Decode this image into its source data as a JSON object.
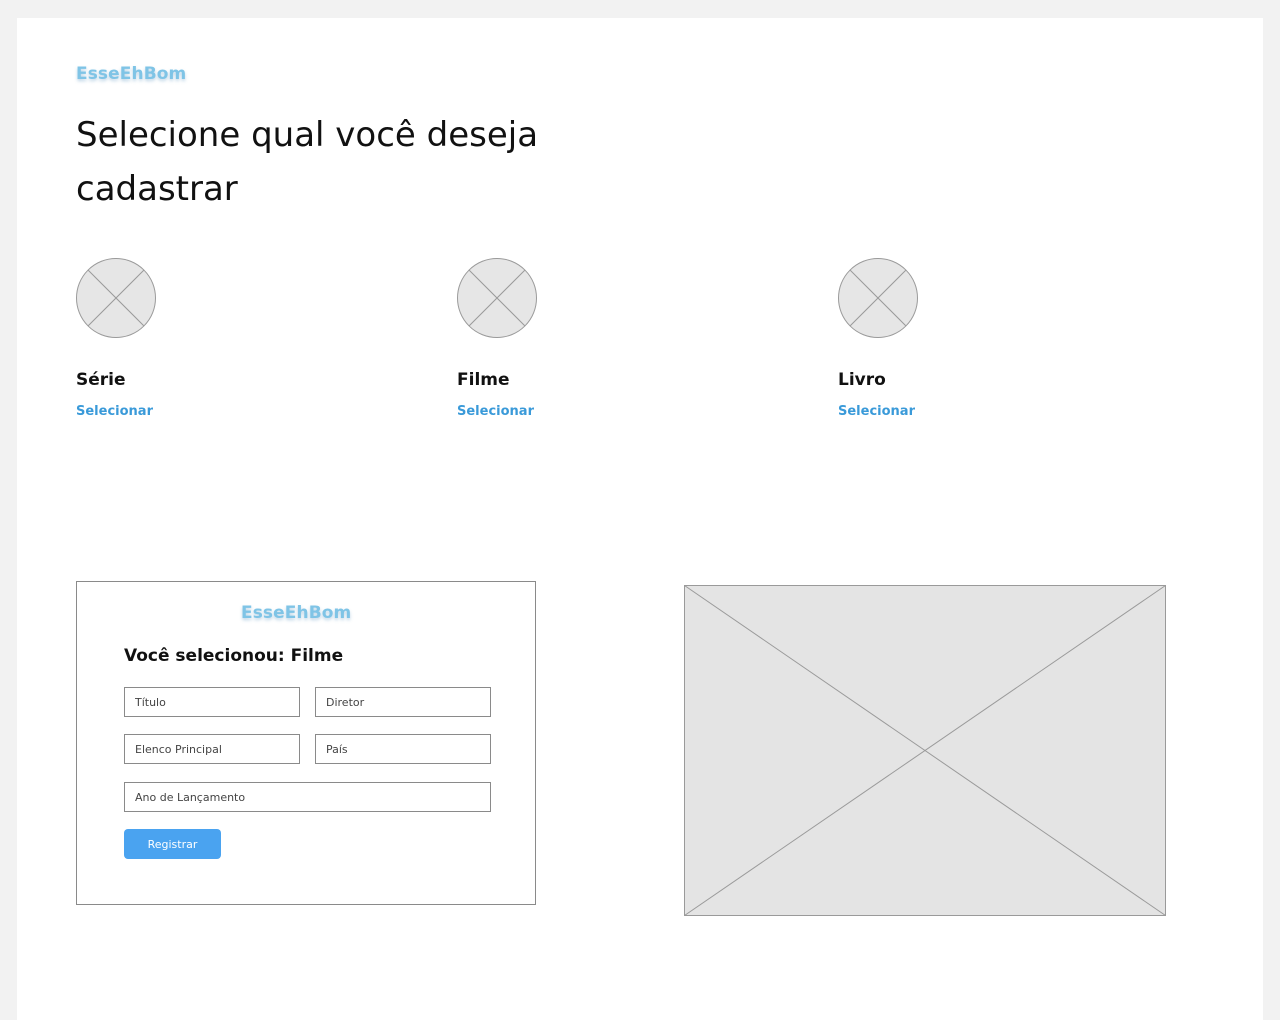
{
  "brand": {
    "logo_text": "EsseEhBom",
    "logo_color": "#7fc4e6",
    "accent_color": "#3a9ad9",
    "button_color": "#4aa3f0"
  },
  "page": {
    "title": "Selecione qual você deseja cadastrar"
  },
  "options": [
    {
      "title": "Série",
      "link_label": "Selecionar",
      "icon": "image-placeholder-icon"
    },
    {
      "title": "Filme",
      "link_label": "Selecionar",
      "icon": "image-placeholder-icon"
    },
    {
      "title": "Livro",
      "link_label": "Selecionar",
      "icon": "image-placeholder-icon"
    }
  ],
  "form": {
    "logo_text": "EsseEhBom",
    "heading": "Você selecionou: Filme",
    "fields": {
      "title_placeholder": "Título",
      "director_placeholder": "Diretor",
      "cast_placeholder": "Elenco Principal",
      "country_placeholder": "País",
      "year_placeholder": "Ano de Lançamento"
    },
    "submit_label": "Registrar"
  },
  "preview": {
    "icon": "image-placeholder-icon"
  }
}
